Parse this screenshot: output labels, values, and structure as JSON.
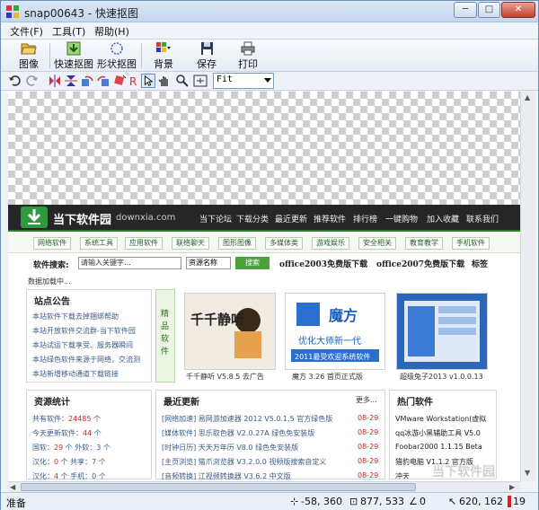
{
  "window": {
    "title": "snap00643 - 快速抠图"
  },
  "window_controls": {
    "minimize": "─",
    "maximize": "□",
    "close": "✕"
  },
  "menu": [
    "文件(F)",
    "工具(T)",
    "帮助(H)"
  ],
  "toolbar": {
    "image": "图像",
    "quick_cut": "快速抠图",
    "shape_cut": "形状抠图",
    "background": "背景",
    "save": "保存",
    "print": "打印"
  },
  "zoom": {
    "value": "Fit"
  },
  "status": {
    "ready": "准备",
    "pos": "-58, 360",
    "size": "877, 533",
    "zero": "0",
    "cursor": "620, 162",
    "extra": "19"
  },
  "webpage": {
    "logo": "当下软件园",
    "domain": "downxia.com",
    "nav": [
      "当下论坛",
      "下载分类",
      "最近更新",
      "推荐软件",
      "排行榜",
      "一键购物",
      "加入收藏",
      "联系我们"
    ],
    "categories": [
      "网络软件",
      "系统工具",
      "应用软件",
      "联络聊天",
      "图形图像",
      "多媒体类",
      "游戏娱乐",
      "安全相关",
      "教育教学",
      "手机软件"
    ],
    "search_label": "软件搜索:",
    "search_placeholder": "请输入关键字...",
    "search_select": "资源名称",
    "search_button": "搜索",
    "hot1": "office2003免费版下载",
    "hot2": "office2007免费版下载",
    "tag": "标签",
    "loading": "数据加载中...",
    "notice_title": "站点公告",
    "notices": [
      "本站软件下载去掉捆绑帮助",
      "本站开放软件交流群-当下软件园",
      "本站试运下载享受、服务器瞬间",
      "本站绿色软件来源于网络，交流测",
      "本站新增移动通道下载链接"
    ],
    "fine": "精品软件",
    "thumbs": [
      {
        "caption": "千千静听 V5.8.5 去广告",
        "art": "千千静听"
      },
      {
        "caption": "魔方 3.26 首页正式版",
        "art": "魔方",
        "sub": "优化大师新一代",
        "sub2": "2011最受欢迎系统软件"
      },
      {
        "caption": "超级兔子2013 v1.0.0.13",
        "art": ""
      }
    ],
    "stats_title": "资源统计",
    "stats": [
      {
        "label": "共有软件：",
        "value": "24485",
        "unit": "个"
      },
      {
        "label": "今天更新软件：",
        "value": "44",
        "unit": "个"
      },
      {
        "label": "国软：",
        "value": "29",
        "unit": "个 外软：3 个"
      },
      {
        "label": "汉化：",
        "value": "0",
        "unit": "个 共享：7 个"
      },
      {
        "label": "汉化：",
        "value": "4",
        "unit": "个 手机：0 个"
      }
    ],
    "recent_title": "最近更新",
    "recent_more": "更多...",
    "recent": [
      {
        "text": "[网络加速] 易网游加速器 2012 V5.0.1.5 官方绿色版",
        "date": "08-29"
      },
      {
        "text": "[媒体软件] 思乐取色器 V2.0.27A 绿色免安装版",
        "date": "08-29"
      },
      {
        "text": "[时钟日历] 天天万年历 V8.0 绿色免安装版",
        "date": "08-29"
      },
      {
        "text": "[主页浏览] 猫爪浏览器 V3.2.0.0 视频版搜索自定义",
        "date": "08-29"
      },
      {
        "text": "[音频转换] 江视频转换器 V3.6.2 中文版",
        "date": "08-29"
      }
    ],
    "hot_title": "热门软件",
    "hot": [
      "VMware Workstation(虚拟",
      "qq冰游小黑辅助工具 V5.0",
      "Foobar2000 1.1.15 Beta",
      "猎豹电脑 V1.1.2 官方版",
      "冲天"
    ]
  },
  "watermark": "当下软件园",
  "colors": {
    "accent": "#2f9a3c",
    "nav_bg": "#262626",
    "title_bar": "#c5d7ee"
  }
}
